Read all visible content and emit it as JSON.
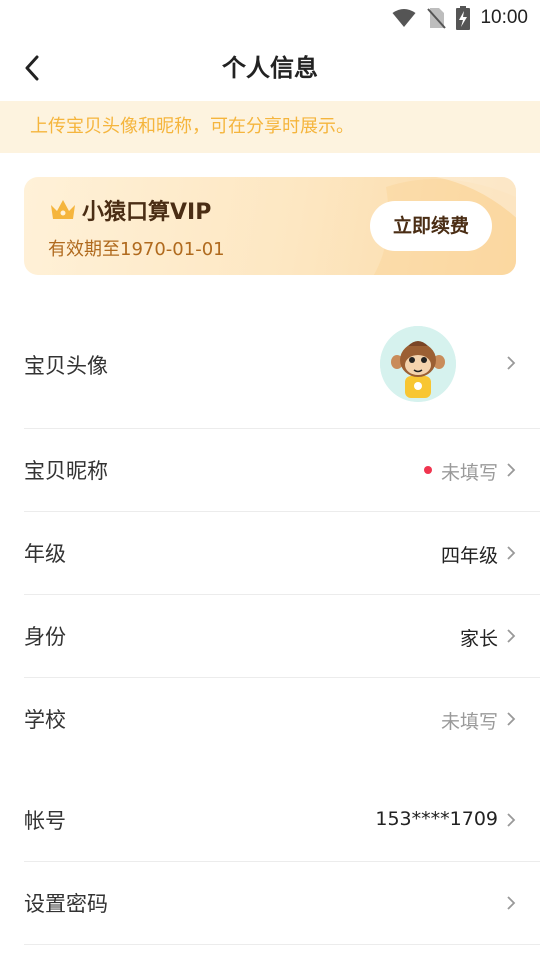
{
  "status_bar": {
    "time": "10:00",
    "icons": [
      "wifi-icon",
      "no-sim-icon",
      "battery-charging-icon"
    ]
  },
  "nav": {
    "title": "个人信息",
    "back_icon": "chevron-left-icon"
  },
  "notice": {
    "text": "上传宝贝头像和昵称，可在分享时展示。"
  },
  "vip_card": {
    "title": "小猿口算VIP",
    "expiry": "有效期至1970-01-01",
    "renew_label": "立即续费",
    "crown_icon": "crown-icon"
  },
  "profile_rows": [
    {
      "label": "宝贝头像",
      "value": ""
    },
    {
      "label": "宝贝昵称",
      "value": "未填写",
      "has_red_dot": true
    },
    {
      "label": "年级",
      "value": "四年级"
    },
    {
      "label": "身份",
      "value": "家长"
    },
    {
      "label": "学校",
      "value": "未填写"
    }
  ],
  "account_rows": [
    {
      "label": "帐号",
      "value": "153****1709"
    },
    {
      "label": "设置密码",
      "value": ""
    }
  ],
  "colors": {
    "accent_orange": "#f5b53d",
    "notice_bg": "#fdf3df",
    "vip_text": "#4a2d14",
    "red_dot": "#f0354f"
  }
}
